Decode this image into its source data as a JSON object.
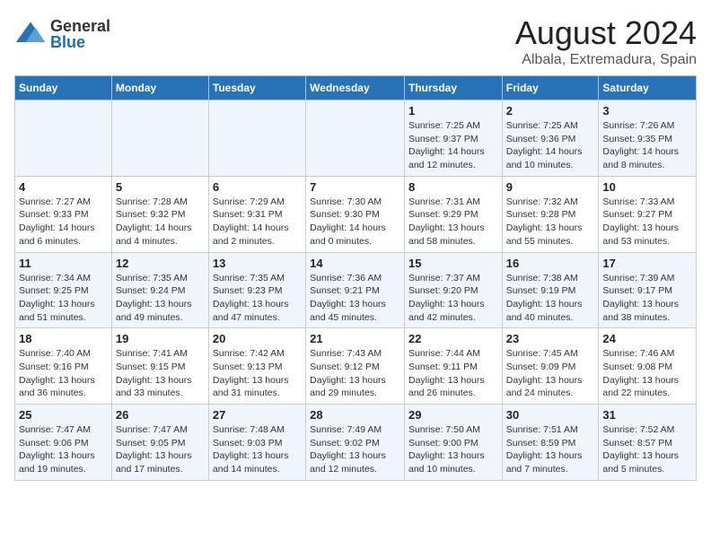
{
  "header": {
    "logo_general": "General",
    "logo_blue": "Blue",
    "title": "August 2024",
    "subtitle": "Albala, Extremadura, Spain"
  },
  "weekdays": [
    "Sunday",
    "Monday",
    "Tuesday",
    "Wednesday",
    "Thursday",
    "Friday",
    "Saturday"
  ],
  "weeks": [
    [
      {
        "day": "",
        "content": ""
      },
      {
        "day": "",
        "content": ""
      },
      {
        "day": "",
        "content": ""
      },
      {
        "day": "",
        "content": ""
      },
      {
        "day": "1",
        "content": "Sunrise: 7:25 AM\nSunset: 9:37 PM\nDaylight: 14 hours\nand 12 minutes."
      },
      {
        "day": "2",
        "content": "Sunrise: 7:25 AM\nSunset: 9:36 PM\nDaylight: 14 hours\nand 10 minutes."
      },
      {
        "day": "3",
        "content": "Sunrise: 7:26 AM\nSunset: 9:35 PM\nDaylight: 14 hours\nand 8 minutes."
      }
    ],
    [
      {
        "day": "4",
        "content": "Sunrise: 7:27 AM\nSunset: 9:33 PM\nDaylight: 14 hours\nand 6 minutes."
      },
      {
        "day": "5",
        "content": "Sunrise: 7:28 AM\nSunset: 9:32 PM\nDaylight: 14 hours\nand 4 minutes."
      },
      {
        "day": "6",
        "content": "Sunrise: 7:29 AM\nSunset: 9:31 PM\nDaylight: 14 hours\nand 2 minutes."
      },
      {
        "day": "7",
        "content": "Sunrise: 7:30 AM\nSunset: 9:30 PM\nDaylight: 14 hours\nand 0 minutes."
      },
      {
        "day": "8",
        "content": "Sunrise: 7:31 AM\nSunset: 9:29 PM\nDaylight: 13 hours\nand 58 minutes."
      },
      {
        "day": "9",
        "content": "Sunrise: 7:32 AM\nSunset: 9:28 PM\nDaylight: 13 hours\nand 55 minutes."
      },
      {
        "day": "10",
        "content": "Sunrise: 7:33 AM\nSunset: 9:27 PM\nDaylight: 13 hours\nand 53 minutes."
      }
    ],
    [
      {
        "day": "11",
        "content": "Sunrise: 7:34 AM\nSunset: 9:25 PM\nDaylight: 13 hours\nand 51 minutes."
      },
      {
        "day": "12",
        "content": "Sunrise: 7:35 AM\nSunset: 9:24 PM\nDaylight: 13 hours\nand 49 minutes."
      },
      {
        "day": "13",
        "content": "Sunrise: 7:35 AM\nSunset: 9:23 PM\nDaylight: 13 hours\nand 47 minutes."
      },
      {
        "day": "14",
        "content": "Sunrise: 7:36 AM\nSunset: 9:21 PM\nDaylight: 13 hours\nand 45 minutes."
      },
      {
        "day": "15",
        "content": "Sunrise: 7:37 AM\nSunset: 9:20 PM\nDaylight: 13 hours\nand 42 minutes."
      },
      {
        "day": "16",
        "content": "Sunrise: 7:38 AM\nSunset: 9:19 PM\nDaylight: 13 hours\nand 40 minutes."
      },
      {
        "day": "17",
        "content": "Sunrise: 7:39 AM\nSunset: 9:17 PM\nDaylight: 13 hours\nand 38 minutes."
      }
    ],
    [
      {
        "day": "18",
        "content": "Sunrise: 7:40 AM\nSunset: 9:16 PM\nDaylight: 13 hours\nand 36 minutes."
      },
      {
        "day": "19",
        "content": "Sunrise: 7:41 AM\nSunset: 9:15 PM\nDaylight: 13 hours\nand 33 minutes."
      },
      {
        "day": "20",
        "content": "Sunrise: 7:42 AM\nSunset: 9:13 PM\nDaylight: 13 hours\nand 31 minutes."
      },
      {
        "day": "21",
        "content": "Sunrise: 7:43 AM\nSunset: 9:12 PM\nDaylight: 13 hours\nand 29 minutes."
      },
      {
        "day": "22",
        "content": "Sunrise: 7:44 AM\nSunset: 9:11 PM\nDaylight: 13 hours\nand 26 minutes."
      },
      {
        "day": "23",
        "content": "Sunrise: 7:45 AM\nSunset: 9:09 PM\nDaylight: 13 hours\nand 24 minutes."
      },
      {
        "day": "24",
        "content": "Sunrise: 7:46 AM\nSunset: 9:08 PM\nDaylight: 13 hours\nand 22 minutes."
      }
    ],
    [
      {
        "day": "25",
        "content": "Sunrise: 7:47 AM\nSunset: 9:06 PM\nDaylight: 13 hours\nand 19 minutes."
      },
      {
        "day": "26",
        "content": "Sunrise: 7:47 AM\nSunset: 9:05 PM\nDaylight: 13 hours\nand 17 minutes."
      },
      {
        "day": "27",
        "content": "Sunrise: 7:48 AM\nSunset: 9:03 PM\nDaylight: 13 hours\nand 14 minutes."
      },
      {
        "day": "28",
        "content": "Sunrise: 7:49 AM\nSunset: 9:02 PM\nDaylight: 13 hours\nand 12 minutes."
      },
      {
        "day": "29",
        "content": "Sunrise: 7:50 AM\nSunset: 9:00 PM\nDaylight: 13 hours\nand 10 minutes."
      },
      {
        "day": "30",
        "content": "Sunrise: 7:51 AM\nSunset: 8:59 PM\nDaylight: 13 hours\nand 7 minutes."
      },
      {
        "day": "31",
        "content": "Sunrise: 7:52 AM\nSunset: 8:57 PM\nDaylight: 13 hours\nand 5 minutes."
      }
    ]
  ]
}
